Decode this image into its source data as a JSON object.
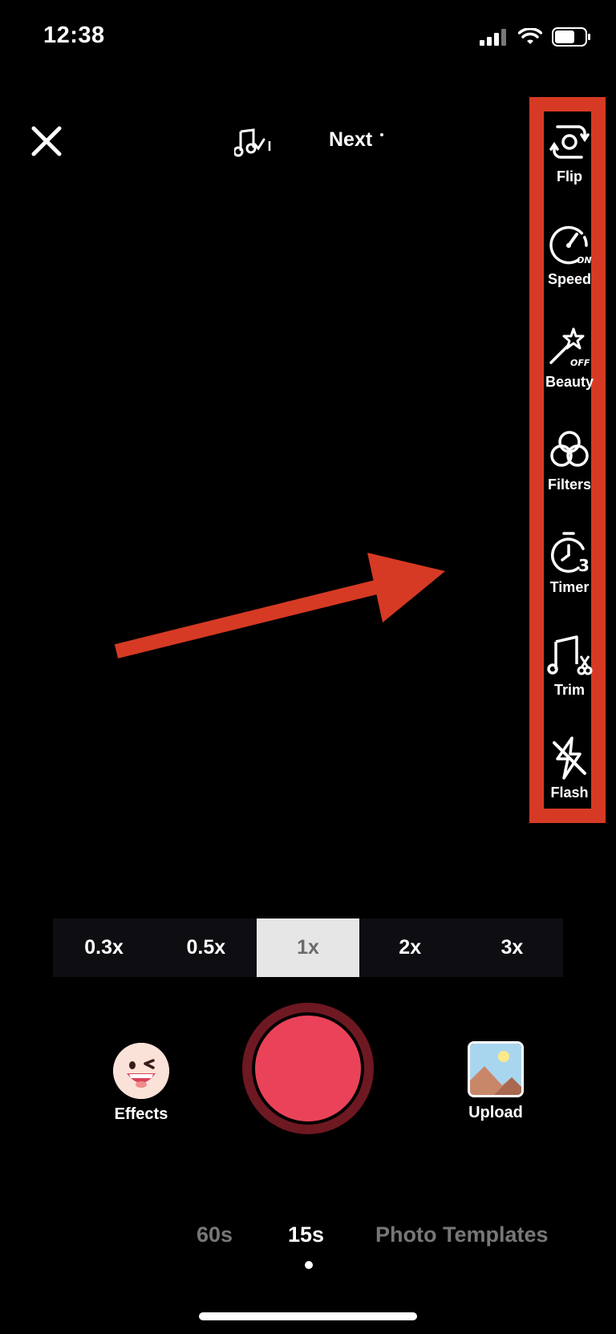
{
  "status_bar": {
    "time": "12:38"
  },
  "top_bar": {
    "next_label": "Next"
  },
  "toolbar": {
    "items": [
      {
        "label": "Flip",
        "icon": "flip-camera-icon"
      },
      {
        "label": "Speed",
        "icon": "speed-icon",
        "badge": "ON"
      },
      {
        "label": "Beauty",
        "icon": "beauty-wand-icon",
        "badge": "OFF"
      },
      {
        "label": "Filters",
        "icon": "filters-icon"
      },
      {
        "label": "Timer",
        "icon": "timer-icon",
        "badge": "3"
      },
      {
        "label": "Trim",
        "icon": "trim-music-icon"
      },
      {
        "label": "Flash",
        "icon": "flash-off-icon"
      }
    ],
    "highlight_color": "#d63a24"
  },
  "zoom": {
    "options": [
      "0.3x",
      "0.5x",
      "1x",
      "2x",
      "3x"
    ],
    "selected": "1x"
  },
  "effects_label": "Effects",
  "upload_label": "Upload",
  "modes": {
    "items": [
      "60s",
      "15s",
      "Photo Templates"
    ],
    "selected": "15s"
  },
  "colors": {
    "record_button": "#ea4359",
    "annotation_arrow": "#d63a24"
  }
}
